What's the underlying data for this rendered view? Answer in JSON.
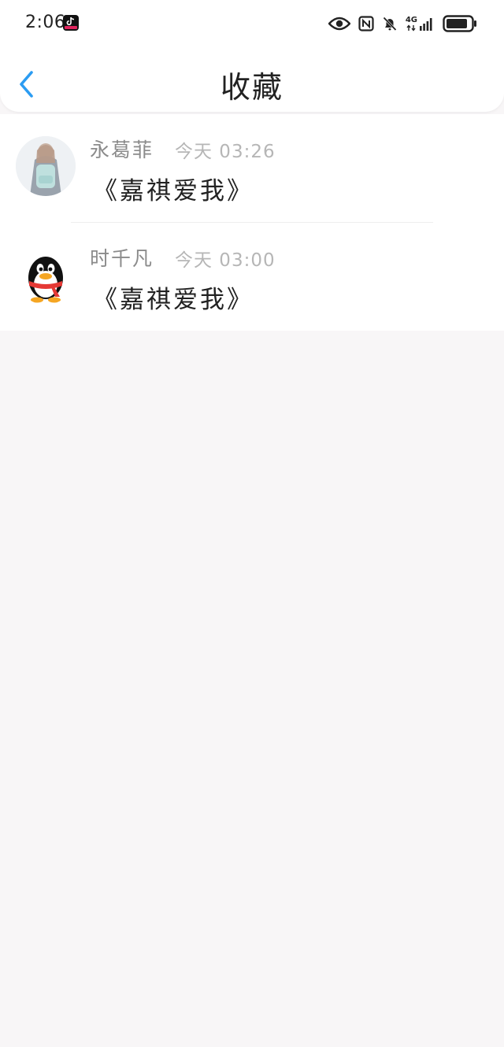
{
  "status_bar": {
    "time": "2:06",
    "network_label": "4G",
    "icons": [
      "tiktok-icon",
      "eye-icon",
      "nfc-icon",
      "bell-off-icon",
      "signal-icon",
      "battery-icon"
    ]
  },
  "header": {
    "title": "收藏",
    "back_icon": "chevron-left-icon"
  },
  "favorites": [
    {
      "name": "永葛菲",
      "time": "今天 03:26",
      "content": "《嘉祺爱我》",
      "avatar": "photo-avatar"
    },
    {
      "name": "时千凡",
      "time": "今天 03:00",
      "content": "《嘉祺爱我》",
      "avatar": "qq-penguin-avatar"
    }
  ],
  "colors": {
    "accent": "#2b9cf2",
    "background": "#f8f6f7",
    "name_text": "#8b8b8b",
    "time_text": "#b6b6b6"
  }
}
